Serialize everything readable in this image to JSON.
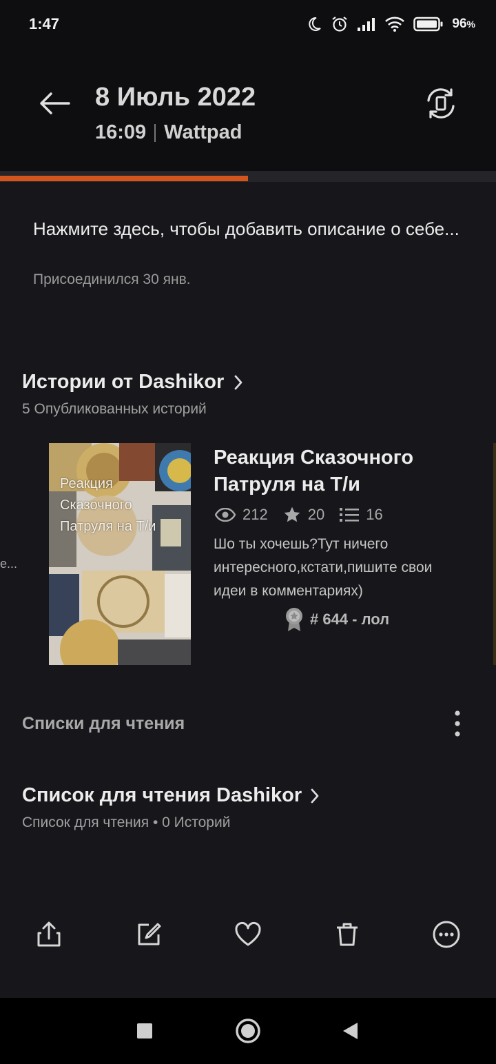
{
  "status_bar": {
    "time": "1:47",
    "battery": "96",
    "battery_unit": "%",
    "icons": [
      "moon-icon",
      "alarm-icon",
      "signal-icon",
      "wifi-icon",
      "battery-icon"
    ]
  },
  "header": {
    "date": "8 Июль 2022",
    "time": "16:09",
    "app": "Wattpad"
  },
  "progress": {
    "fraction": 0.5,
    "color": "#d4541d"
  },
  "profile": {
    "about_placeholder": "Нажмите здесь, чтобы добавить описание о себе...",
    "joined": "Присоединился 30 янв."
  },
  "stories": {
    "title": "Истории от Dashikor",
    "subtitle": "5 Опубликованных историй",
    "left_ellipsis": "е...",
    "book": {
      "cover_text": "Реакция Сказочного Патруля на Т/и",
      "title": "Реакция Сказочного Патруля на Т/и",
      "views": "212",
      "votes": "20",
      "parts": "16",
      "description": "Шо ты хочешь?Тут ничего интересного,кстати,пишите свои идеи в комментариях)",
      "rank": "# 644 - лол"
    }
  },
  "reading_lists": {
    "header": "Списки для чтения",
    "item_title": "Список для чтения Dashikor",
    "item_subtitle": "Список для чтения • 0 Историй"
  },
  "toolbar": {
    "buttons": [
      "share-icon",
      "edit-icon",
      "heart-icon",
      "trash-icon",
      "more-icon"
    ]
  },
  "colors": {
    "accent": "#d4541d",
    "background": "#17161a",
    "header_bg": "#0e0e10"
  }
}
